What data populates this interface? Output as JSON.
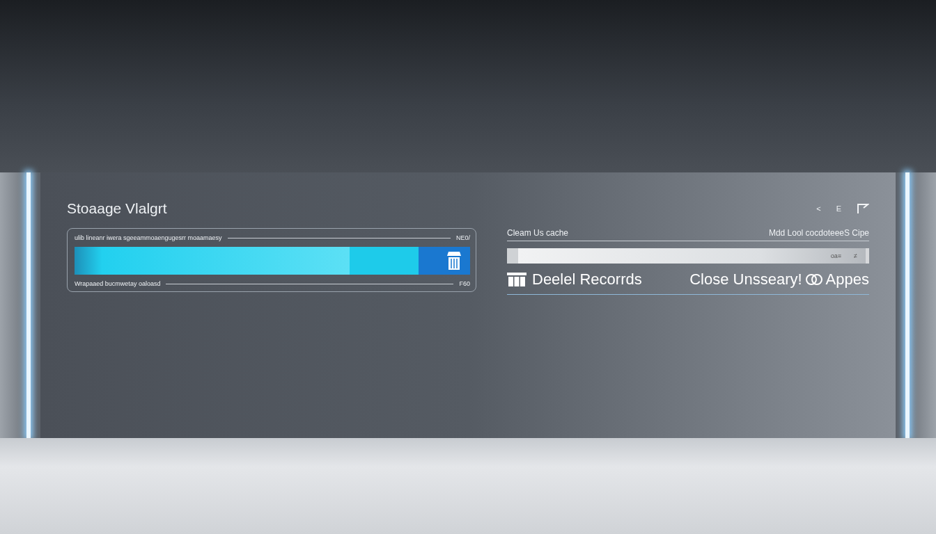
{
  "title": "Stoaage Vlalgrt",
  "toolbar": [
    "<",
    "E"
  ],
  "storage": {
    "caption": "ulib lineanr iwera sgeeammoaengugesrr moaamaesy",
    "total": "NE0/",
    "level": 0.87,
    "footer": "Wrapaaed bucmwetay oaloasd",
    "footer_value": "F60"
  },
  "cache": {
    "label": "Cleam Us cache",
    "detail": "Mdd Lool cocdoteeeS Cipe",
    "level": 0.99,
    "bar_text": "oa≡",
    "bar_sign": "≠"
  },
  "actions": [
    {
      "kind": "delete",
      "label": "Deelel Recorrds"
    },
    {
      "kind": "close",
      "label": "Close Unsseary!",
      "suffix": "Appes"
    }
  ]
}
